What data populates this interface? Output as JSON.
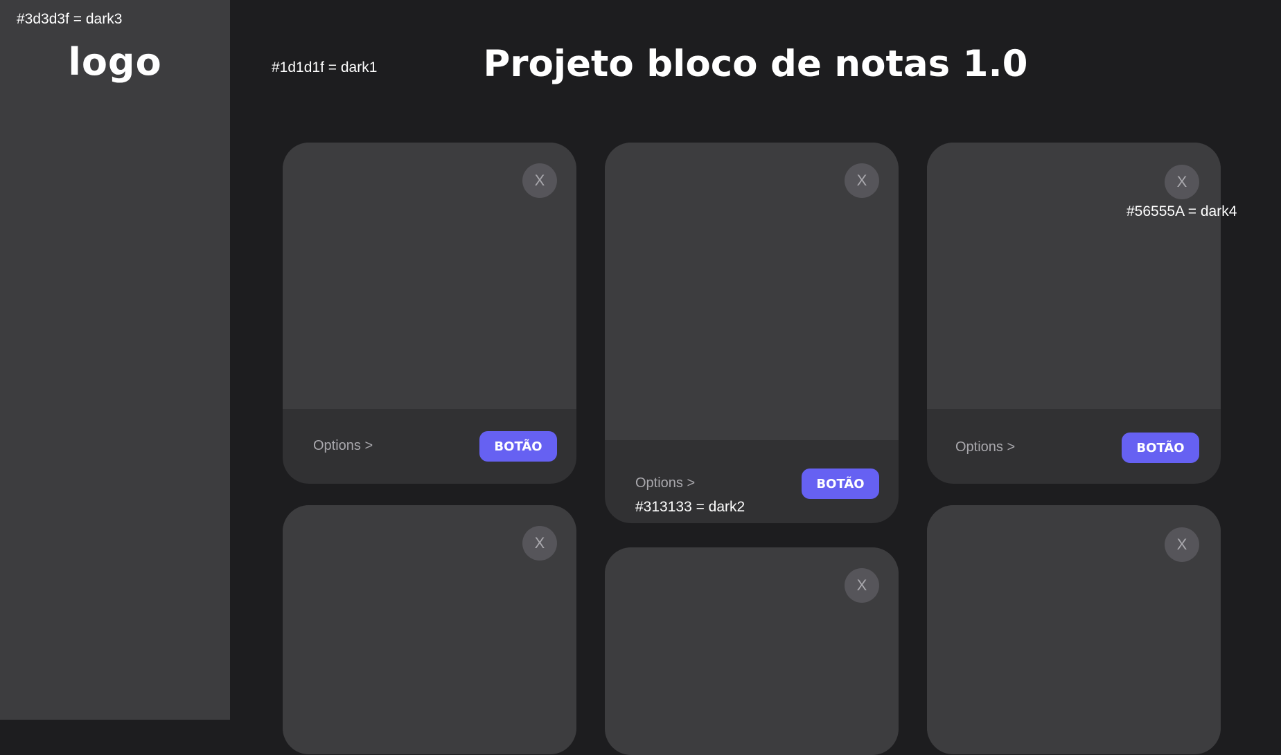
{
  "annotations": {
    "dark3": "#3d3d3f = dark3",
    "dark1": "#1d1d1f = dark1",
    "dark4": "#56555A = dark4",
    "dark2": "#313133 = dark2"
  },
  "sidebar": {
    "logo": "logo"
  },
  "header": {
    "title": "Projeto bloco de notas 1.0"
  },
  "cards": [
    {
      "close": "X",
      "options": "Options >",
      "button": "BOTÃO"
    },
    {
      "close": "X",
      "options": "Options >",
      "button": "BOTÃO"
    },
    {
      "close": "X",
      "options": "Options >",
      "button": "BOTÃO"
    },
    {
      "close": "X"
    },
    {
      "close": "X"
    },
    {
      "close": "X"
    }
  ],
  "colors": {
    "dark1": "#1d1d1f",
    "dark2": "#313133",
    "dark3": "#3d3d3f",
    "dark4": "#56555a",
    "accent": "#6661f2"
  }
}
